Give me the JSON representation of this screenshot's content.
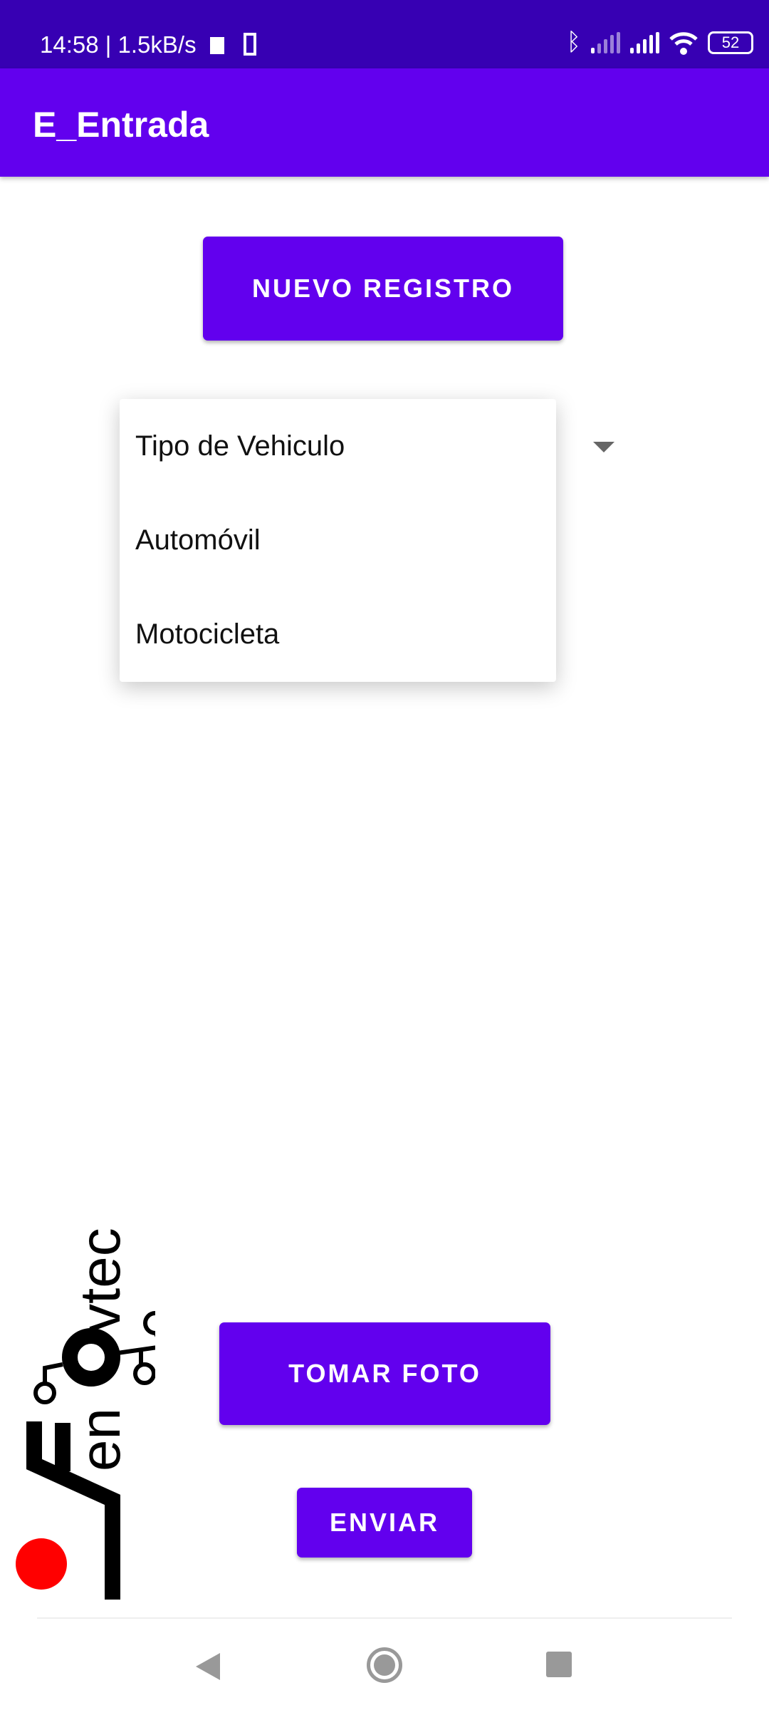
{
  "status_bar": {
    "time": "14:58",
    "network_speed": "1.5kB/s",
    "battery": "52",
    "icons": [
      "keyboard-icon",
      "phone-icon",
      "bluetooth-icon",
      "signal-icon",
      "signal-icon",
      "wifi-icon",
      "battery-icon"
    ]
  },
  "app_bar": {
    "title": "E_Entrada"
  },
  "buttons": {
    "nuevo_registro": "NUEVO REGISTRO",
    "tomar_foto": "TOMAR FOTO",
    "enviar": "ENVIAR"
  },
  "spinner": {
    "options": [
      "Tipo de Vehiculo",
      "Automóvil",
      "Motocicleta"
    ]
  },
  "logo": {
    "text": "Fenovtec"
  },
  "colors": {
    "primary": "#6200ee",
    "primary_dark": "#3700b3",
    "logo_red": "#ff0000"
  },
  "nav": {
    "icons": [
      "back-icon",
      "home-icon",
      "recents-icon"
    ]
  }
}
